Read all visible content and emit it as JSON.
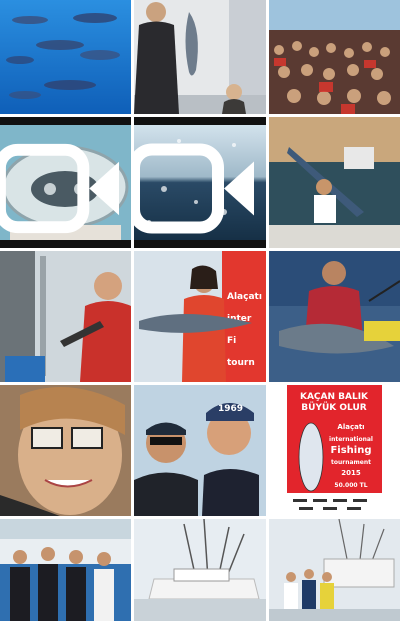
{
  "grid": {
    "columns": 3,
    "rows": 5
  },
  "tiles": [
    {
      "id": "tunas-underwater",
      "video": false
    },
    {
      "id": "man-holding-tuna",
      "video": false
    },
    {
      "id": "crowd-at-event",
      "video": false
    },
    {
      "id": "boat-cockpit-dome",
      "video": true
    },
    {
      "id": "water-drops-sea",
      "video": true
    },
    {
      "id": "man-with-marlin",
      "video": false
    },
    {
      "id": "man-on-boat-rod",
      "video": false
    },
    {
      "id": "woman-with-tuna",
      "video": false
    },
    {
      "id": "man-in-red-hoodie-tuna",
      "video": false
    },
    {
      "id": "smiling-woman-sunglasses",
      "video": false
    },
    {
      "id": "two-men-selfie",
      "video": false
    },
    {
      "id": "tournament-poster",
      "video": false
    },
    {
      "id": "women-group-photo",
      "video": false
    },
    {
      "id": "white-yacht",
      "video": false
    },
    {
      "id": "people-on-boat-deck",
      "video": false
    }
  ],
  "poster": {
    "headline_1": "KAÇAN BALIK",
    "headline_2": "BÜYÜK OLUR",
    "brand": "Alaçatı",
    "title_1": "international",
    "title_2": "Fishing",
    "title_3": "tournament",
    "year": "2015",
    "prize": "50.000 TL"
  },
  "cap_text": "1969",
  "banner_text_1": "Alaçatı",
  "banner_text_2": "inter",
  "banner_text_3": "Fi",
  "banner_text_4": "tourn",
  "colors": {
    "poster_red": "#e2252c",
    "sea_blue": "#1f6fc6",
    "divider": "#ffffff"
  }
}
